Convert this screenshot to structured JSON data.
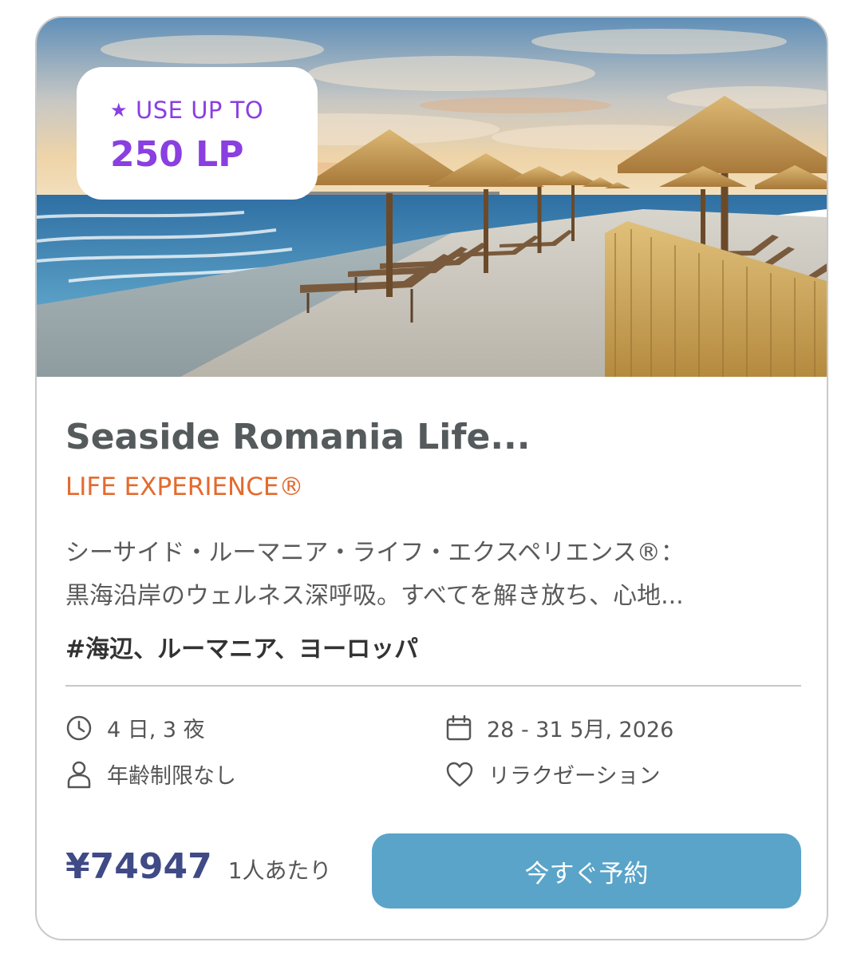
{
  "badge": {
    "star": "★",
    "top_label": "USE UP TO",
    "amount": "250 LP"
  },
  "product": {
    "title": "Seaside Romania Life...",
    "subtitle": "LIFE EXPERIENCE®",
    "description_lines": [
      "シーサイド・ルーマニア・ライフ・エクスペリエンス®：",
      "黒海沿岸のウェルネス深呼吸。すべてを解き放ち、心地..."
    ],
    "tags": "#海辺、ルーマニア、ヨーロッパ"
  },
  "details": {
    "duration": "4 日, 3 夜",
    "dates": "28 - 31 5月, 2026",
    "age": "年齢制限なし",
    "theme": "リラクゼーション"
  },
  "pricing": {
    "price": "¥74947",
    "per_person": "1人あたり"
  },
  "cta": {
    "book_label": "今すぐ予約"
  },
  "colors": {
    "lp_accent": "#8a3fe0",
    "subtitle": "#e46a2e",
    "price": "#3f4a86",
    "button": "#5aa4c9"
  },
  "icons": {
    "duration": "clock-icon",
    "dates": "calendar-icon",
    "age": "person-icon",
    "theme": "heart-icon"
  }
}
